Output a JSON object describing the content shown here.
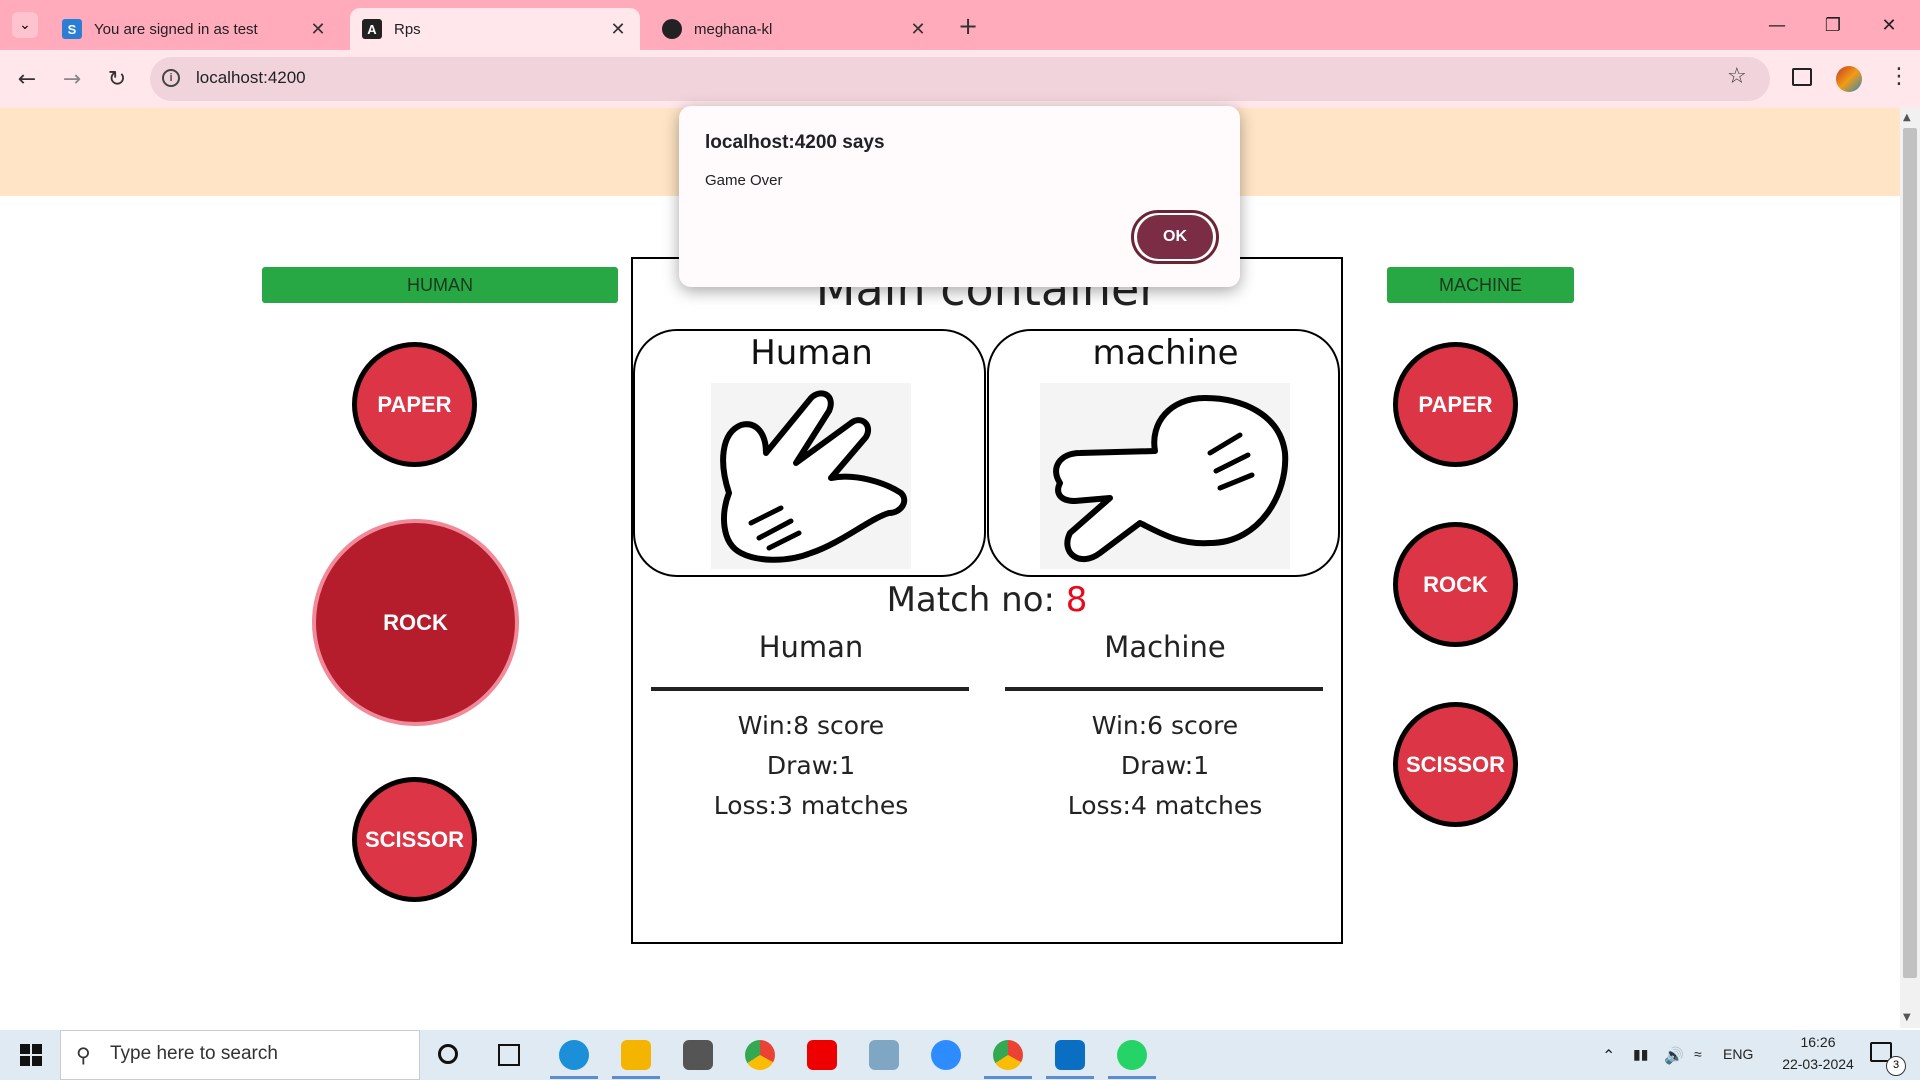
{
  "browser": {
    "tabs": [
      {
        "title": "You are signed in as test",
        "favicon": "S"
      },
      {
        "title": "Rps",
        "favicon": "A"
      },
      {
        "title": "meghana-kl",
        "favicon": "github"
      }
    ],
    "address": "localhost:4200"
  },
  "left_panel": {
    "label": "HUMAN",
    "buttons": [
      "PAPER",
      "ROCK",
      "SCISSOR"
    ]
  },
  "right_panel": {
    "label": "MACHINE",
    "buttons": [
      "PAPER",
      "ROCK",
      "SCISSOR"
    ]
  },
  "main": {
    "title": "Main container",
    "human_card_title": "Human",
    "machine_card_title": "machine",
    "match_label": "Match no: ",
    "match_number": "8",
    "human": {
      "heading": "Human",
      "win": "Win:8 score",
      "draw": "Draw:1",
      "loss": "Loss:3 matches"
    },
    "machine": {
      "heading": "Machine",
      "win": "Win:6 score",
      "draw": "Draw:1",
      "loss": "Loss:4 matches"
    }
  },
  "dialog": {
    "title": "localhost:4200 says",
    "message": "Game Over",
    "ok_label": "OK"
  },
  "taskbar": {
    "search_placeholder": "Type here to search",
    "lang": "ENG",
    "time": "16:26",
    "date": "22-03-2024",
    "notification_count": "3"
  },
  "colors": {
    "tabbar": "#ffabbc",
    "banner": "#ffe5c5",
    "label_green": "#28a745",
    "button_red": "#dc3545",
    "match_number": "#e8091c",
    "dialog_ok": "#7a2d44"
  }
}
